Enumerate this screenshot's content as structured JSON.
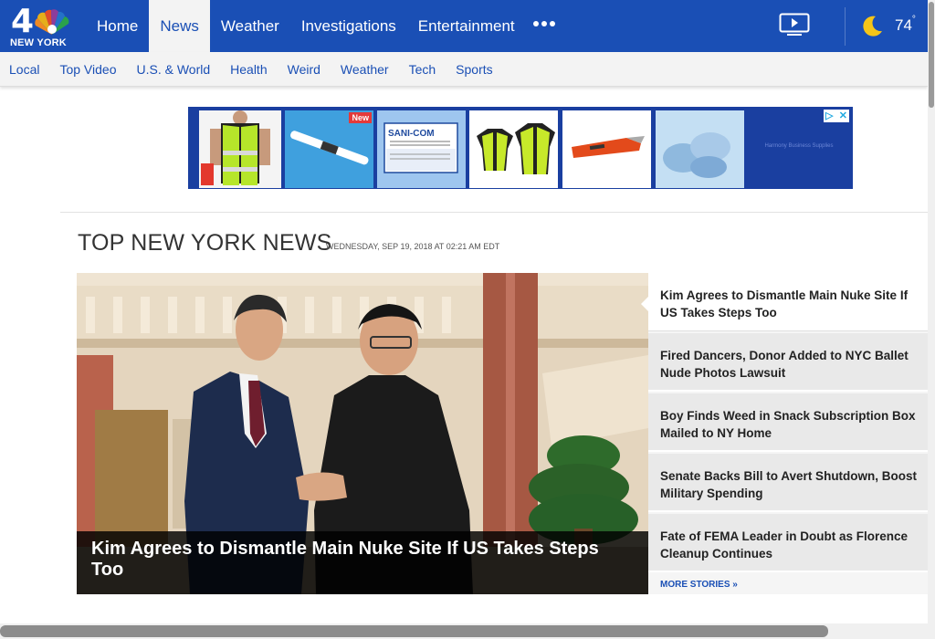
{
  "brand": {
    "number": "4",
    "name": "NEW YORK"
  },
  "nav": {
    "items": [
      "Home",
      "News",
      "Weather",
      "Investigations",
      "Entertainment"
    ],
    "active": "News",
    "more_icon": "ellipsis-icon"
  },
  "weather": {
    "temperature": "74",
    "degree": "°",
    "icon": "moon-icon"
  },
  "subnav": {
    "items": [
      "Local",
      "Top Video",
      "U.S. & World",
      "Health",
      "Weird",
      "Weather",
      "Tech",
      "Sports"
    ]
  },
  "ad": {
    "new_badge": "New",
    "product_label": "SANI-COM",
    "sponsor": "Harmony Business Supplies"
  },
  "section": {
    "title": "TOP NEW YORK NEWS",
    "date": "WEDNESDAY, SEP 19, 2018 AT 02:21 AM EDT"
  },
  "hero": {
    "headline": "Kim Agrees to Dismantle Main Nuke Site If US Takes Steps Too"
  },
  "stories": [
    "Kim Agrees to Dismantle Main Nuke Site If US Takes Steps Too",
    "Fired Dancers, Donor Added to NYC Ballet Nude Photos Lawsuit",
    "Boy Finds Weed in Snack Subscription Box Mailed to NY Home",
    "Senate Backs Bill to Avert Shutdown, Boost Military Spending",
    "Fate of FEMA Leader in Doubt as Florence Cleanup Continues"
  ],
  "more_stories": "MORE STORIES »",
  "colors": {
    "brand_blue": "#1a4fb5",
    "ad_blue": "#1a3fa0",
    "caption_bg": "#000000"
  }
}
